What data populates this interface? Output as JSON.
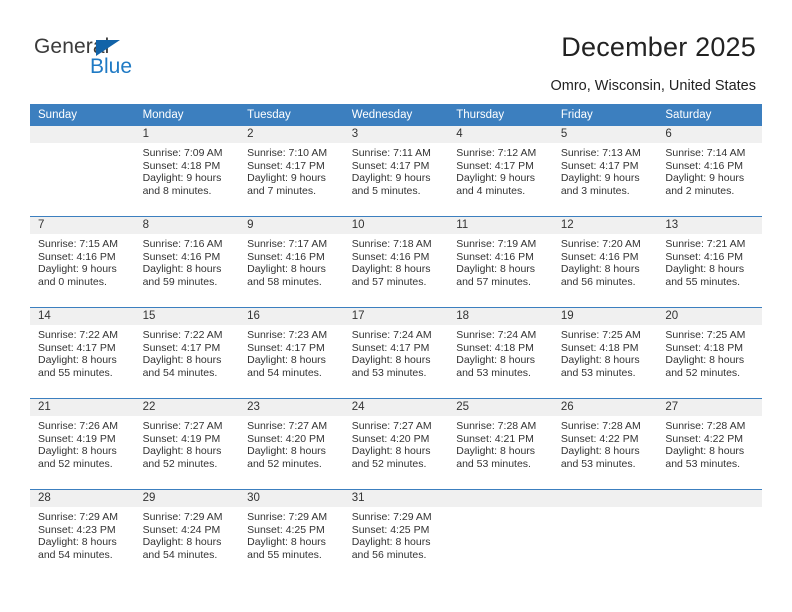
{
  "brand": {
    "name_part1": "General",
    "name_part2": "Blue",
    "triangle_icon": "triangle-icon",
    "accent_color": "#1f7ac4"
  },
  "header": {
    "title": "December 2025",
    "subtitle": "Omro, Wisconsin, United States",
    "header_bg_color": "#3c7fbf",
    "daynum_bg_color": "#f0f0f0"
  },
  "calendar": {
    "weekday_headers": [
      "Sunday",
      "Monday",
      "Tuesday",
      "Wednesday",
      "Thursday",
      "Friday",
      "Saturday"
    ],
    "weeks": [
      [
        {
          "day": "",
          "empty": true,
          "sunrise": "",
          "sunset": "",
          "daylight_line1": "",
          "daylight_line2": ""
        },
        {
          "day": "1",
          "empty": false,
          "sunrise": "Sunrise: 7:09 AM",
          "sunset": "Sunset: 4:18 PM",
          "daylight_line1": "Daylight: 9 hours",
          "daylight_line2": "and 8 minutes."
        },
        {
          "day": "2",
          "empty": false,
          "sunrise": "Sunrise: 7:10 AM",
          "sunset": "Sunset: 4:17 PM",
          "daylight_line1": "Daylight: 9 hours",
          "daylight_line2": "and 7 minutes."
        },
        {
          "day": "3",
          "empty": false,
          "sunrise": "Sunrise: 7:11 AM",
          "sunset": "Sunset: 4:17 PM",
          "daylight_line1": "Daylight: 9 hours",
          "daylight_line2": "and 5 minutes."
        },
        {
          "day": "4",
          "empty": false,
          "sunrise": "Sunrise: 7:12 AM",
          "sunset": "Sunset: 4:17 PM",
          "daylight_line1": "Daylight: 9 hours",
          "daylight_line2": "and 4 minutes."
        },
        {
          "day": "5",
          "empty": false,
          "sunrise": "Sunrise: 7:13 AM",
          "sunset": "Sunset: 4:17 PM",
          "daylight_line1": "Daylight: 9 hours",
          "daylight_line2": "and 3 minutes."
        },
        {
          "day": "6",
          "empty": false,
          "sunrise": "Sunrise: 7:14 AM",
          "sunset": "Sunset: 4:16 PM",
          "daylight_line1": "Daylight: 9 hours",
          "daylight_line2": "and 2 minutes."
        }
      ],
      [
        {
          "day": "7",
          "empty": false,
          "sunrise": "Sunrise: 7:15 AM",
          "sunset": "Sunset: 4:16 PM",
          "daylight_line1": "Daylight: 9 hours",
          "daylight_line2": "and 0 minutes."
        },
        {
          "day": "8",
          "empty": false,
          "sunrise": "Sunrise: 7:16 AM",
          "sunset": "Sunset: 4:16 PM",
          "daylight_line1": "Daylight: 8 hours",
          "daylight_line2": "and 59 minutes."
        },
        {
          "day": "9",
          "empty": false,
          "sunrise": "Sunrise: 7:17 AM",
          "sunset": "Sunset: 4:16 PM",
          "daylight_line1": "Daylight: 8 hours",
          "daylight_line2": "and 58 minutes."
        },
        {
          "day": "10",
          "empty": false,
          "sunrise": "Sunrise: 7:18 AM",
          "sunset": "Sunset: 4:16 PM",
          "daylight_line1": "Daylight: 8 hours",
          "daylight_line2": "and 57 minutes."
        },
        {
          "day": "11",
          "empty": false,
          "sunrise": "Sunrise: 7:19 AM",
          "sunset": "Sunset: 4:16 PM",
          "daylight_line1": "Daylight: 8 hours",
          "daylight_line2": "and 57 minutes."
        },
        {
          "day": "12",
          "empty": false,
          "sunrise": "Sunrise: 7:20 AM",
          "sunset": "Sunset: 4:16 PM",
          "daylight_line1": "Daylight: 8 hours",
          "daylight_line2": "and 56 minutes."
        },
        {
          "day": "13",
          "empty": false,
          "sunrise": "Sunrise: 7:21 AM",
          "sunset": "Sunset: 4:16 PM",
          "daylight_line1": "Daylight: 8 hours",
          "daylight_line2": "and 55 minutes."
        }
      ],
      [
        {
          "day": "14",
          "empty": false,
          "sunrise": "Sunrise: 7:22 AM",
          "sunset": "Sunset: 4:17 PM",
          "daylight_line1": "Daylight: 8 hours",
          "daylight_line2": "and 55 minutes."
        },
        {
          "day": "15",
          "empty": false,
          "sunrise": "Sunrise: 7:22 AM",
          "sunset": "Sunset: 4:17 PM",
          "daylight_line1": "Daylight: 8 hours",
          "daylight_line2": "and 54 minutes."
        },
        {
          "day": "16",
          "empty": false,
          "sunrise": "Sunrise: 7:23 AM",
          "sunset": "Sunset: 4:17 PM",
          "daylight_line1": "Daylight: 8 hours",
          "daylight_line2": "and 54 minutes."
        },
        {
          "day": "17",
          "empty": false,
          "sunrise": "Sunrise: 7:24 AM",
          "sunset": "Sunset: 4:17 PM",
          "daylight_line1": "Daylight: 8 hours",
          "daylight_line2": "and 53 minutes."
        },
        {
          "day": "18",
          "empty": false,
          "sunrise": "Sunrise: 7:24 AM",
          "sunset": "Sunset: 4:18 PM",
          "daylight_line1": "Daylight: 8 hours",
          "daylight_line2": "and 53 minutes."
        },
        {
          "day": "19",
          "empty": false,
          "sunrise": "Sunrise: 7:25 AM",
          "sunset": "Sunset: 4:18 PM",
          "daylight_line1": "Daylight: 8 hours",
          "daylight_line2": "and 53 minutes."
        },
        {
          "day": "20",
          "empty": false,
          "sunrise": "Sunrise: 7:25 AM",
          "sunset": "Sunset: 4:18 PM",
          "daylight_line1": "Daylight: 8 hours",
          "daylight_line2": "and 52 minutes."
        }
      ],
      [
        {
          "day": "21",
          "empty": false,
          "sunrise": "Sunrise: 7:26 AM",
          "sunset": "Sunset: 4:19 PM",
          "daylight_line1": "Daylight: 8 hours",
          "daylight_line2": "and 52 minutes."
        },
        {
          "day": "22",
          "empty": false,
          "sunrise": "Sunrise: 7:27 AM",
          "sunset": "Sunset: 4:19 PM",
          "daylight_line1": "Daylight: 8 hours",
          "daylight_line2": "and 52 minutes."
        },
        {
          "day": "23",
          "empty": false,
          "sunrise": "Sunrise: 7:27 AM",
          "sunset": "Sunset: 4:20 PM",
          "daylight_line1": "Daylight: 8 hours",
          "daylight_line2": "and 52 minutes."
        },
        {
          "day": "24",
          "empty": false,
          "sunrise": "Sunrise: 7:27 AM",
          "sunset": "Sunset: 4:20 PM",
          "daylight_line1": "Daylight: 8 hours",
          "daylight_line2": "and 52 minutes."
        },
        {
          "day": "25",
          "empty": false,
          "sunrise": "Sunrise: 7:28 AM",
          "sunset": "Sunset: 4:21 PM",
          "daylight_line1": "Daylight: 8 hours",
          "daylight_line2": "and 53 minutes."
        },
        {
          "day": "26",
          "empty": false,
          "sunrise": "Sunrise: 7:28 AM",
          "sunset": "Sunset: 4:22 PM",
          "daylight_line1": "Daylight: 8 hours",
          "daylight_line2": "and 53 minutes."
        },
        {
          "day": "27",
          "empty": false,
          "sunrise": "Sunrise: 7:28 AM",
          "sunset": "Sunset: 4:22 PM",
          "daylight_line1": "Daylight: 8 hours",
          "daylight_line2": "and 53 minutes."
        }
      ],
      [
        {
          "day": "28",
          "empty": false,
          "sunrise": "Sunrise: 7:29 AM",
          "sunset": "Sunset: 4:23 PM",
          "daylight_line1": "Daylight: 8 hours",
          "daylight_line2": "and 54 minutes."
        },
        {
          "day": "29",
          "empty": false,
          "sunrise": "Sunrise: 7:29 AM",
          "sunset": "Sunset: 4:24 PM",
          "daylight_line1": "Daylight: 8 hours",
          "daylight_line2": "and 54 minutes."
        },
        {
          "day": "30",
          "empty": false,
          "sunrise": "Sunrise: 7:29 AM",
          "sunset": "Sunset: 4:25 PM",
          "daylight_line1": "Daylight: 8 hours",
          "daylight_line2": "and 55 minutes."
        },
        {
          "day": "31",
          "empty": false,
          "sunrise": "Sunrise: 7:29 AM",
          "sunset": "Sunset: 4:25 PM",
          "daylight_line1": "Daylight: 8 hours",
          "daylight_line2": "and 56 minutes."
        },
        {
          "day": "",
          "empty": true,
          "sunrise": "",
          "sunset": "",
          "daylight_line1": "",
          "daylight_line2": ""
        },
        {
          "day": "",
          "empty": true,
          "sunrise": "",
          "sunset": "",
          "daylight_line1": "",
          "daylight_line2": ""
        },
        {
          "day": "",
          "empty": true,
          "sunrise": "",
          "sunset": "",
          "daylight_line1": "",
          "daylight_line2": ""
        }
      ]
    ]
  }
}
